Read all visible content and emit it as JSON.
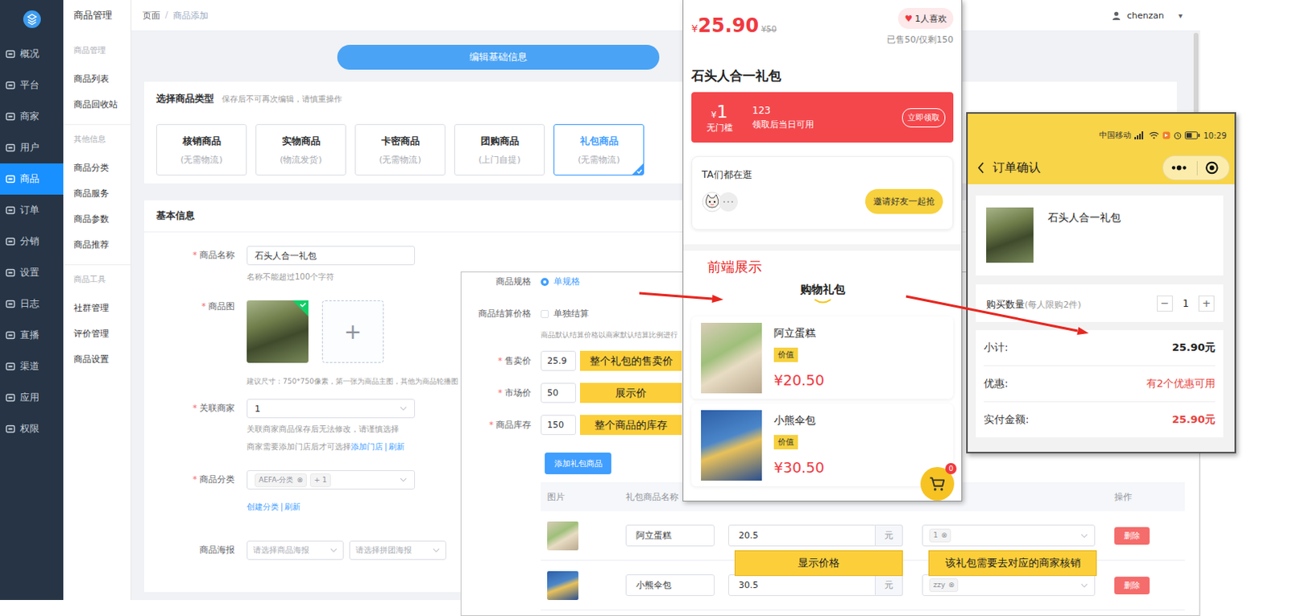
{
  "admin": {
    "main_nav": [
      {
        "label": "概况",
        "selected": false
      },
      {
        "label": "平台",
        "selected": false
      },
      {
        "label": "商家",
        "selected": false
      },
      {
        "label": "用户",
        "selected": false
      },
      {
        "label": "商品",
        "selected": true
      },
      {
        "label": "订单",
        "selected": false
      },
      {
        "label": "分销",
        "selected": false
      },
      {
        "label": "设置",
        "selected": false
      },
      {
        "label": "日志",
        "selected": false
      },
      {
        "label": "直播",
        "selected": false
      },
      {
        "label": "渠道",
        "selected": false
      },
      {
        "label": "应用",
        "selected": false
      },
      {
        "label": "权限",
        "selected": false
      }
    ],
    "sub_nav": {
      "title": "商品管理",
      "groups": [
        {
          "label": "商品管理",
          "items": [
            {
              "label": "商品列表",
              "selected": false
            },
            {
              "label": "商品回收站",
              "selected": false
            }
          ]
        },
        {
          "label": "其他信息",
          "items": [
            {
              "label": "商品分类",
              "selected": false
            },
            {
              "label": "商品服务",
              "selected": false
            },
            {
              "label": "商品参数",
              "selected": false
            },
            {
              "label": "商品推荐",
              "selected": false
            }
          ]
        },
        {
          "label": "商品工具",
          "items": [
            {
              "label": "社群管理",
              "selected": false
            },
            {
              "label": "评价管理",
              "selected": false
            },
            {
              "label": "商品设置",
              "selected": false
            }
          ]
        }
      ]
    },
    "breadcrumb": {
      "items": [
        "页面",
        "商品添加"
      ],
      "separator": "/"
    },
    "user": {
      "name": "chenzan",
      "caret": "▾"
    },
    "edit_button": "编辑基础信息",
    "type_section": {
      "title": "选择商品类型",
      "note": "保存后不可再次编辑，请慎重操作",
      "types": [
        {
          "name": "核销商品",
          "desc": "(无需物流)",
          "selected": false
        },
        {
          "name": "实物商品",
          "desc": "(物流发货)",
          "selected": false
        },
        {
          "name": "卡密商品",
          "desc": "(无需物流)",
          "selected": false
        },
        {
          "name": "团购商品",
          "desc": "(上门自提)",
          "selected": false
        },
        {
          "name": "礼包商品",
          "desc": "(无需物流)",
          "selected": true
        }
      ]
    },
    "basic_section": {
      "title": "基本信息",
      "required_mark": "*",
      "name_field": {
        "label": "商品名称",
        "required": true,
        "value": "石头人合一礼包",
        "hint": "名称不能超过100个字符"
      },
      "image_field": {
        "label": "商品图",
        "required": true,
        "add": "+",
        "hint": "建议尺寸：750*750像素，第一张为商品主图，其他为商品轮播图"
      },
      "merchant_field": {
        "label": "关联商家",
        "required": true,
        "value": "1",
        "hint": "关联商家商品保存后无法修改，请谨慎选择",
        "store_hint": "商家需要添加门店后才可选择",
        "links": [
          "添加门店",
          "刷新"
        ],
        "link_separator": "|"
      },
      "category_field": {
        "label": "商品分类",
        "required": true,
        "tags": [
          {
            "label": "AEFA-分类",
            "closable": true
          },
          {
            "label": "+ 1",
            "closable": false
          }
        ],
        "close": "⊗",
        "links": [
          "创建分类",
          "刷新"
        ],
        "link_separator": "|"
      },
      "poster_field": {
        "label": "商品海报",
        "required": false,
        "selects": [
          "请选择商品海报",
          "请选择拼团海报"
        ]
      }
    }
  },
  "gift_panel": {
    "spec": {
      "label": "商品规格",
      "options": [
        {
          "label": "单规格",
          "selected": true
        }
      ]
    },
    "settlement": {
      "label": "商品结算价格",
      "option": {
        "label": "单独结算",
        "checked": false
      },
      "note": "商品默认结算价格以商家默认结算比例进行"
    },
    "required_mark": "*",
    "fields": [
      {
        "label": "售卖价",
        "value": "25.9",
        "annotation": "整个礼包的售卖价"
      },
      {
        "label": "市场价",
        "value": "50",
        "annotation": "展示价"
      },
      {
        "label": "商品库存",
        "value": "150",
        "annotation": "整个商品的库存"
      }
    ],
    "add_button": "添加礼包商品",
    "table": {
      "columns": {
        "image": "图片",
        "name": "礼包商品名称",
        "action": "操作"
      },
      "tag_close": "⊗",
      "rows": [
        {
          "name": "阿立蛋糕",
          "price": "20.5",
          "unit": "元",
          "merchant": "1",
          "action": "删除"
        },
        {
          "name": "小熊伞包",
          "price": "30.5",
          "unit": "元",
          "merchant": "zzy",
          "action": "删除"
        }
      ]
    },
    "annotations": {
      "price": "显示价格",
      "merchant": "该礼包需要去对应的商家核销"
    }
  },
  "front_preview": {
    "currency": "¥",
    "price": "25.90",
    "original_price": "¥50",
    "likes": {
      "icon": "♥",
      "label": "1人喜欢"
    },
    "sales": "已售50/仅剩150",
    "title": "石头人合一礼包",
    "coupon": {
      "currency": "¥",
      "amount": "1",
      "condition": "无门槛",
      "name": "123",
      "desc": "领取后当日可用",
      "button": "立即领取"
    },
    "browsing": {
      "title": "TA们都在逛",
      "button": "邀请好友一起抢"
    },
    "annotation": "前端展示",
    "section_title": "购物礼包",
    "items": [
      {
        "name": "阿立蛋糕",
        "tag": "价值",
        "price": "¥20.50"
      },
      {
        "name": "小熊伞包",
        "tag": "价值",
        "price": "¥30.50"
      }
    ],
    "cart_count": "0"
  },
  "order_confirm": {
    "status_bar": {
      "carrier": "中国移动",
      "time": "10:29"
    },
    "title": "订单确认",
    "product": {
      "name": "石头人合一礼包"
    },
    "quantity": {
      "label": "购买数量",
      "limit": "(每人限购2件)",
      "minus": "−",
      "value": "1",
      "plus": "+"
    },
    "summary": [
      {
        "label": "小计:",
        "value": "25.90元",
        "kind": "plain"
      },
      {
        "label": "优惠:",
        "value": "有2个优惠可用",
        "kind": "discount"
      },
      {
        "label": "实付金额:",
        "value": "25.90元",
        "kind": "total"
      }
    ]
  }
}
